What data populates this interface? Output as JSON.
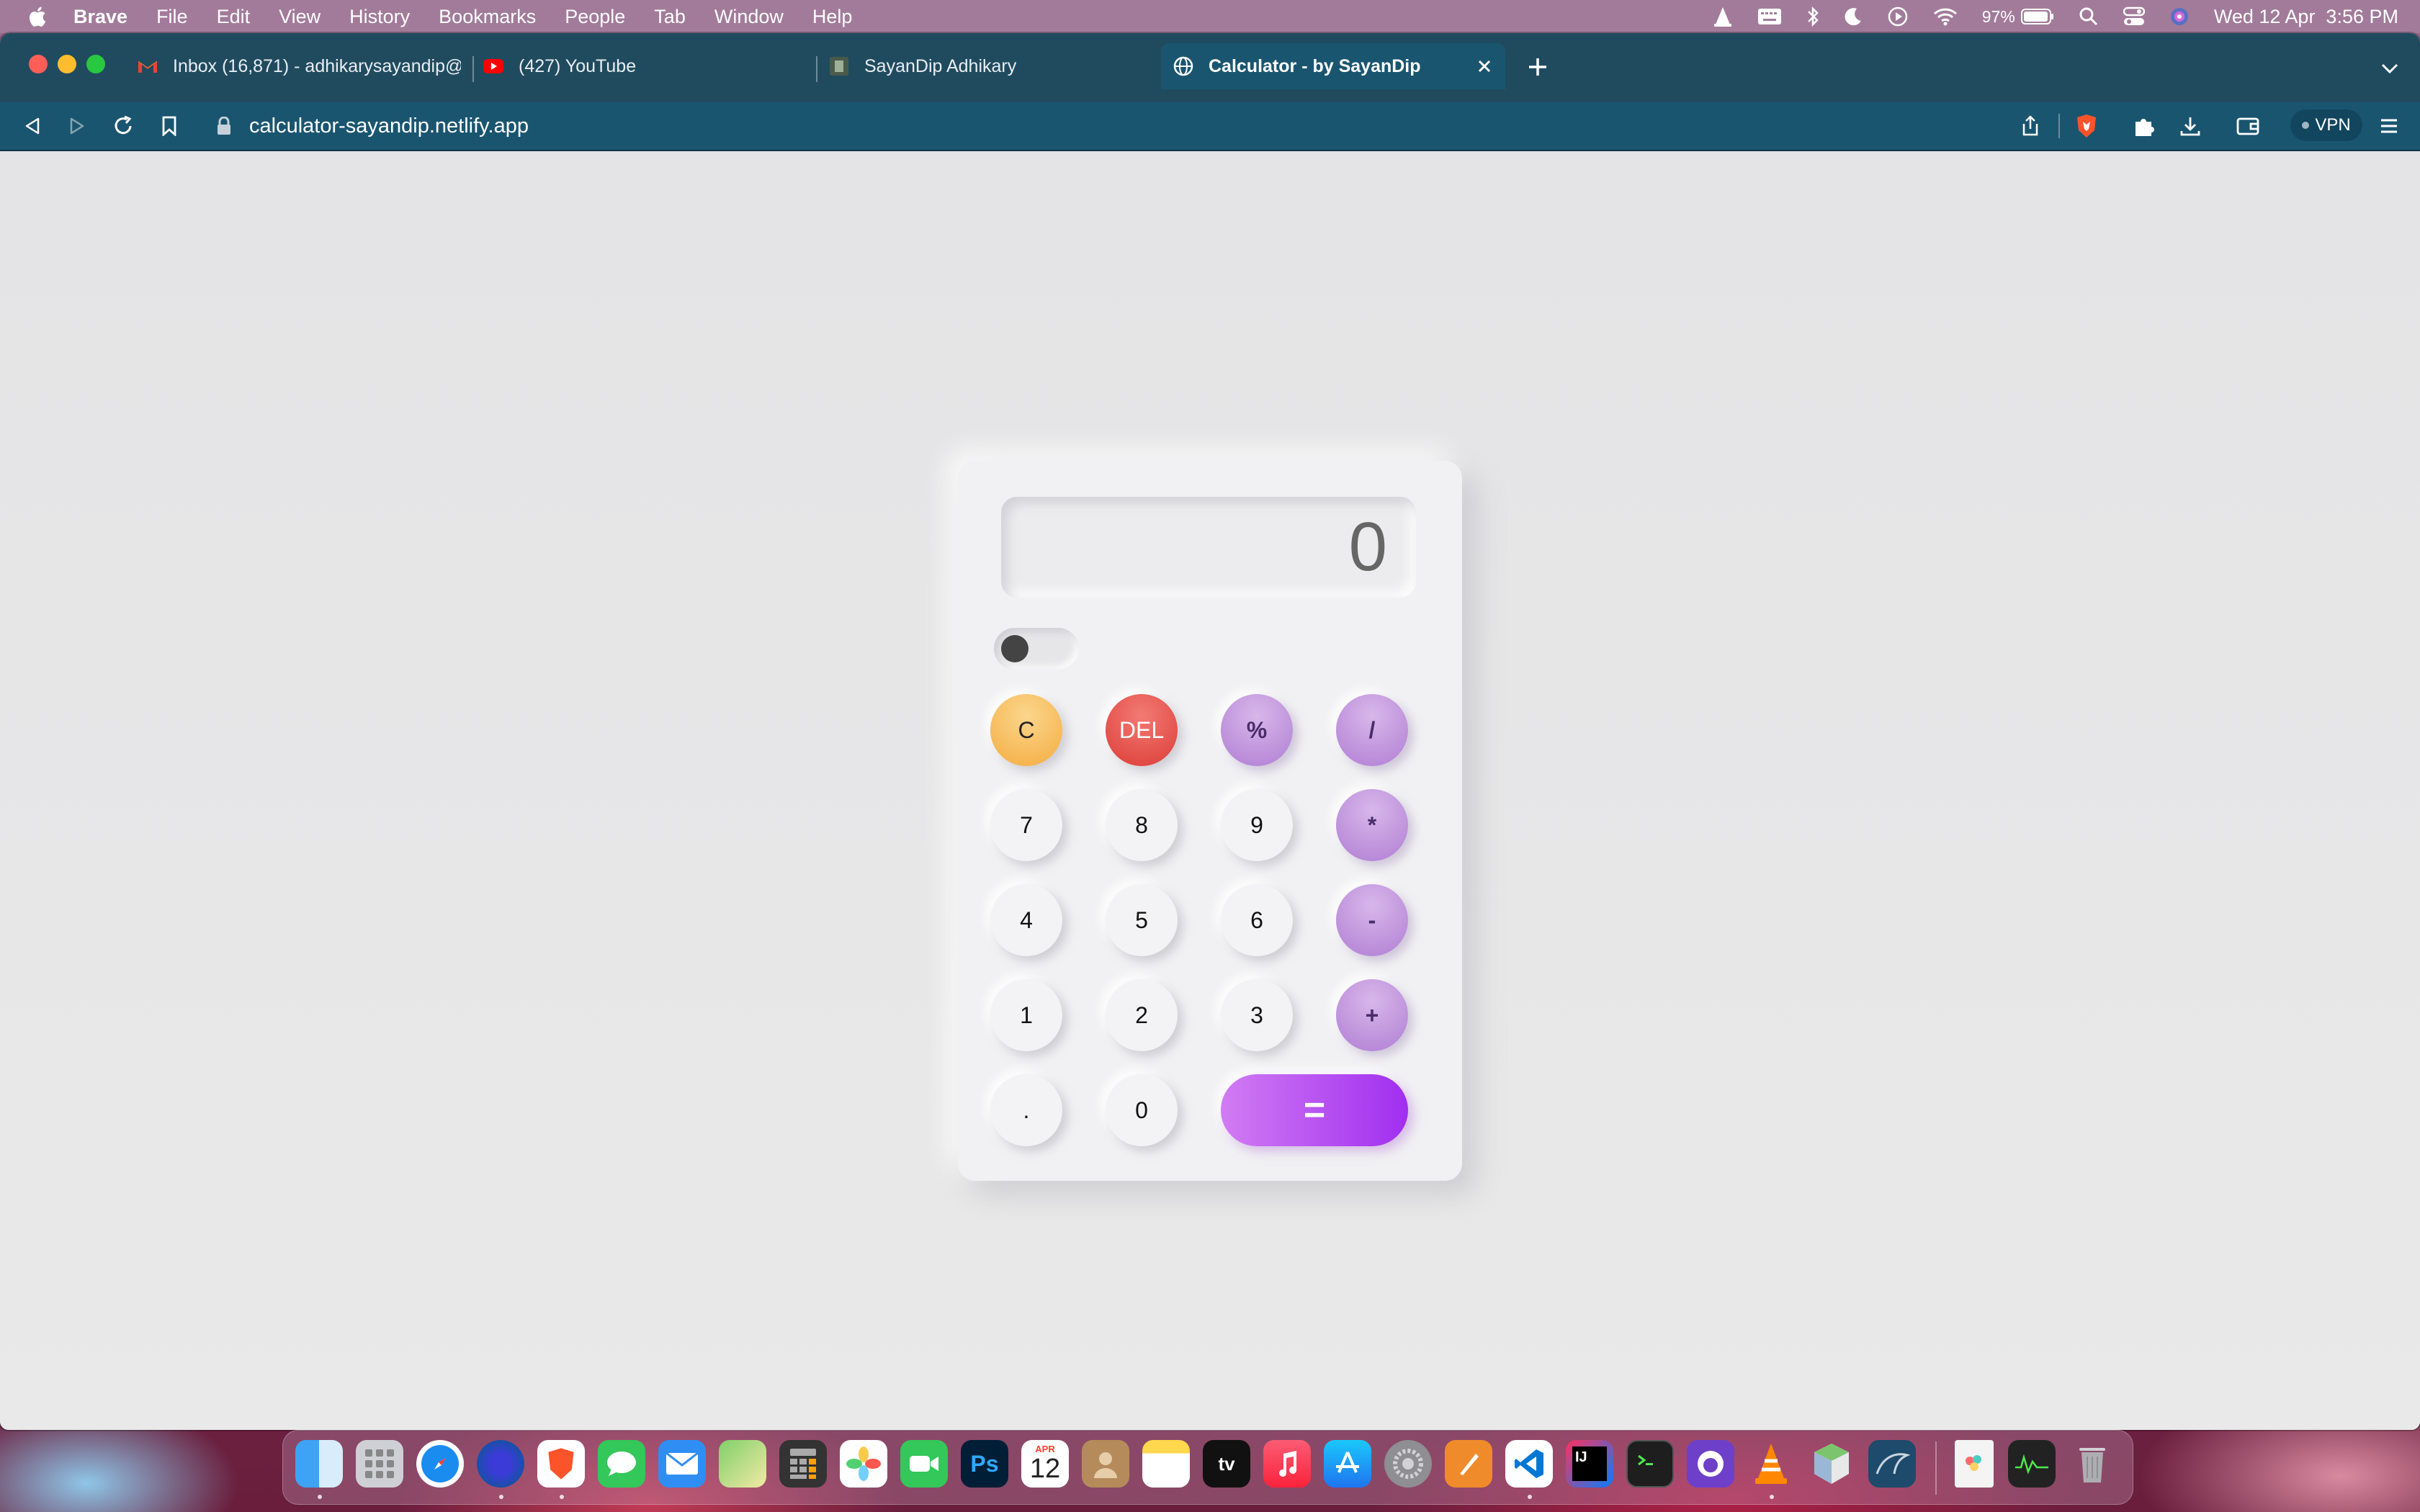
{
  "menubar": {
    "app": "Brave",
    "items": [
      "File",
      "Edit",
      "View",
      "History",
      "Bookmarks",
      "People",
      "Tab",
      "Window",
      "Help"
    ],
    "battery": "97%",
    "datetime": "Wed 12 Apr  3:56 PM"
  },
  "tabs": [
    {
      "title": "Inbox (16,871) - adhikarysayandip@",
      "icon": "gmail-icon"
    },
    {
      "title": "(427) YouTube",
      "icon": "youtube-icon"
    },
    {
      "title": "SayanDip Adhikary",
      "icon": "site-icon"
    },
    {
      "title": "Calculator - by SayanDip",
      "icon": "globe-icon",
      "active": true
    }
  ],
  "toolbar": {
    "url": "calculator-sayandip.netlify.app",
    "vpn": "VPN"
  },
  "calculator": {
    "display": "0",
    "toggle": "off",
    "keys": {
      "clear": "C",
      "del": "DEL",
      "percent": "%",
      "divide": "/",
      "k7": "7",
      "k8": "8",
      "k9": "9",
      "multiply": "*",
      "k4": "4",
      "k5": "5",
      "k6": "6",
      "minus": "-",
      "k1": "1",
      "k2": "2",
      "k3": "3",
      "plus": "+",
      "dot": ".",
      "k0": "0",
      "equals": "="
    }
  },
  "dock": {
    "calendar_month": "APR",
    "calendar_day": "12",
    "apps": [
      "Finder",
      "Launchpad",
      "Safari",
      "Firefox",
      "Brave",
      "Messages",
      "Mail",
      "Maps",
      "Calculator",
      "Photos",
      "FaceTime",
      "Photoshop",
      "Calendar",
      "Contacts",
      "Notes",
      "Apple TV",
      "Music",
      "App Store",
      "System Settings",
      "Pages",
      "VS Code",
      "IntelliJ IDEA",
      "Terminal",
      "GitHub Desktop",
      "VLC",
      "Box App",
      "MySQL Workbench",
      "XMP File",
      "Activity Monitor",
      "Trash"
    ]
  },
  "colors": {
    "tabbar": "#204b5f",
    "toolbar": "#1a5570",
    "operator": "#b889d8",
    "clear": "#f5b24c",
    "delete": "#e04540",
    "equals_start": "#d17cf3",
    "equals_end": "#a12ef0"
  }
}
